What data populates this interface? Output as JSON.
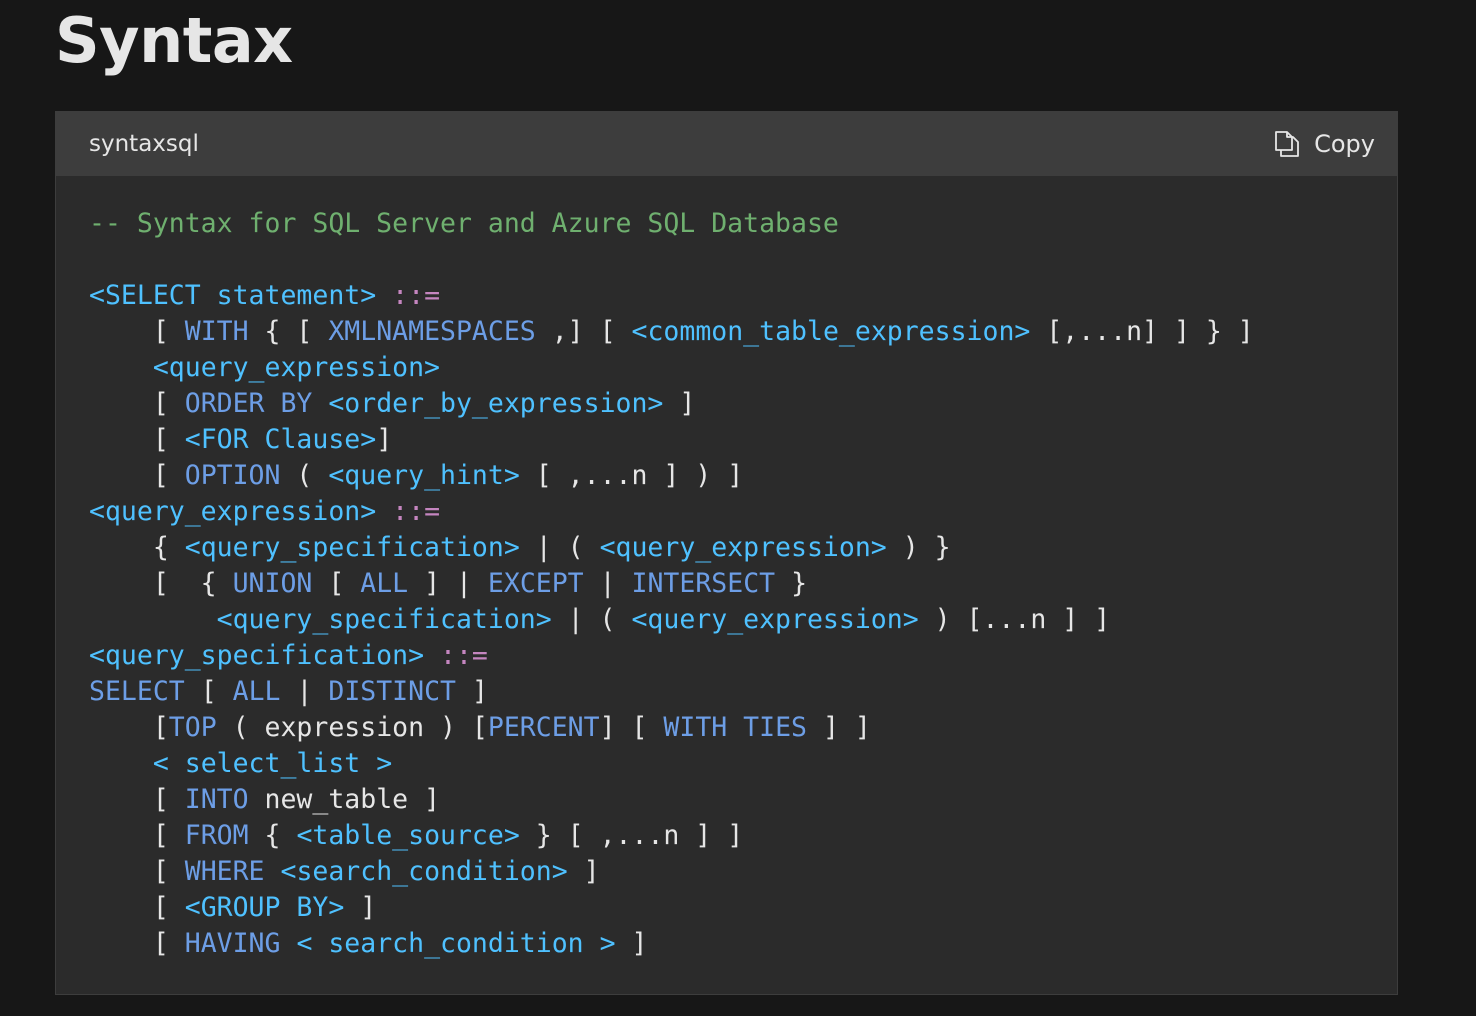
{
  "heading": "Syntax",
  "code_block": {
    "language": "syntaxsql",
    "copy_label": "Copy",
    "copy_icon": "copy-icon",
    "colors": {
      "comment": "#6fb06f",
      "keyword": "#6d9ee6",
      "identifier": "#4fc1ff",
      "operator": "#c586c0",
      "text": "#e6e6e6"
    },
    "lines": [
      [
        {
          "t": "-- Syntax for SQL Server and Azure SQL Database",
          "c": "comment"
        }
      ],
      [],
      [
        {
          "t": "<SELECT statement>",
          "c": "ident"
        },
        {
          "t": " ",
          "c": "punct"
        },
        {
          "t": "::=",
          "c": "op"
        }
      ],
      [
        {
          "t": "    [ ",
          "c": "punct"
        },
        {
          "t": "WITH",
          "c": "keyword"
        },
        {
          "t": " { [ ",
          "c": "punct"
        },
        {
          "t": "XMLNAMESPACES",
          "c": "keyword"
        },
        {
          "t": " ,] [ ",
          "c": "punct"
        },
        {
          "t": "<common_table_expression>",
          "c": "ident"
        },
        {
          "t": " [,...n] ] } ]",
          "c": "punct"
        }
      ],
      [
        {
          "t": "    ",
          "c": "punct"
        },
        {
          "t": "<query_expression>",
          "c": "ident"
        }
      ],
      [
        {
          "t": "    [ ",
          "c": "punct"
        },
        {
          "t": "ORDER BY",
          "c": "keyword"
        },
        {
          "t": " ",
          "c": "punct"
        },
        {
          "t": "<order_by_expression>",
          "c": "ident"
        },
        {
          "t": " ]",
          "c": "punct"
        }
      ],
      [
        {
          "t": "    [ ",
          "c": "punct"
        },
        {
          "t": "<FOR Clause>",
          "c": "ident"
        },
        {
          "t": "]",
          "c": "punct"
        }
      ],
      [
        {
          "t": "    [ ",
          "c": "punct"
        },
        {
          "t": "OPTION",
          "c": "keyword"
        },
        {
          "t": " ( ",
          "c": "punct"
        },
        {
          "t": "<query_hint>",
          "c": "ident"
        },
        {
          "t": " [ ,...n ] ) ]",
          "c": "punct"
        }
      ],
      [
        {
          "t": "<query_expression>",
          "c": "ident"
        },
        {
          "t": " ",
          "c": "punct"
        },
        {
          "t": "::=",
          "c": "op"
        }
      ],
      [
        {
          "t": "    { ",
          "c": "punct"
        },
        {
          "t": "<query_specification>",
          "c": "ident"
        },
        {
          "t": " | ( ",
          "c": "punct"
        },
        {
          "t": "<query_expression>",
          "c": "ident"
        },
        {
          "t": " ) }",
          "c": "punct"
        }
      ],
      [
        {
          "t": "    [  { ",
          "c": "punct"
        },
        {
          "t": "UNION",
          "c": "keyword"
        },
        {
          "t": " [ ",
          "c": "punct"
        },
        {
          "t": "ALL",
          "c": "keyword"
        },
        {
          "t": " ] | ",
          "c": "punct"
        },
        {
          "t": "EXCEPT",
          "c": "keyword"
        },
        {
          "t": " | ",
          "c": "punct"
        },
        {
          "t": "INTERSECT",
          "c": "keyword"
        },
        {
          "t": " }",
          "c": "punct"
        }
      ],
      [
        {
          "t": "        ",
          "c": "punct"
        },
        {
          "t": "<query_specification>",
          "c": "ident"
        },
        {
          "t": " | ( ",
          "c": "punct"
        },
        {
          "t": "<query_expression>",
          "c": "ident"
        },
        {
          "t": " ) [...n ] ]",
          "c": "punct"
        }
      ],
      [
        {
          "t": "<query_specification>",
          "c": "ident"
        },
        {
          "t": " ",
          "c": "punct"
        },
        {
          "t": "::=",
          "c": "op"
        }
      ],
      [
        {
          "t": "SELECT",
          "c": "keyword"
        },
        {
          "t": " [ ",
          "c": "punct"
        },
        {
          "t": "ALL",
          "c": "keyword"
        },
        {
          "t": " | ",
          "c": "punct"
        },
        {
          "t": "DISTINCT",
          "c": "keyword"
        },
        {
          "t": " ]",
          "c": "punct"
        }
      ],
      [
        {
          "t": "    [",
          "c": "punct"
        },
        {
          "t": "TOP",
          "c": "keyword"
        },
        {
          "t": " ( expression ) [",
          "c": "punct"
        },
        {
          "t": "PERCENT",
          "c": "keyword"
        },
        {
          "t": "] [ ",
          "c": "punct"
        },
        {
          "t": "WITH TIES",
          "c": "keyword"
        },
        {
          "t": " ] ]",
          "c": "punct"
        }
      ],
      [
        {
          "t": "    ",
          "c": "punct"
        },
        {
          "t": "< select_list >",
          "c": "ident"
        }
      ],
      [
        {
          "t": "    [ ",
          "c": "punct"
        },
        {
          "t": "INTO",
          "c": "keyword"
        },
        {
          "t": " new_table ]",
          "c": "punct"
        }
      ],
      [
        {
          "t": "    [ ",
          "c": "punct"
        },
        {
          "t": "FROM",
          "c": "keyword"
        },
        {
          "t": " { ",
          "c": "punct"
        },
        {
          "t": "<table_source>",
          "c": "ident"
        },
        {
          "t": " } [ ,...n ] ]",
          "c": "punct"
        }
      ],
      [
        {
          "t": "    [ ",
          "c": "punct"
        },
        {
          "t": "WHERE",
          "c": "keyword"
        },
        {
          "t": " ",
          "c": "punct"
        },
        {
          "t": "<search_condition>",
          "c": "ident"
        },
        {
          "t": " ]",
          "c": "punct"
        }
      ],
      [
        {
          "t": "    [ ",
          "c": "punct"
        },
        {
          "t": "<GROUP BY>",
          "c": "ident"
        },
        {
          "t": " ]",
          "c": "punct"
        }
      ],
      [
        {
          "t": "    [ ",
          "c": "punct"
        },
        {
          "t": "HAVING",
          "c": "keyword"
        },
        {
          "t": " ",
          "c": "punct"
        },
        {
          "t": "< search_condition >",
          "c": "ident"
        },
        {
          "t": " ]",
          "c": "punct"
        }
      ]
    ]
  }
}
